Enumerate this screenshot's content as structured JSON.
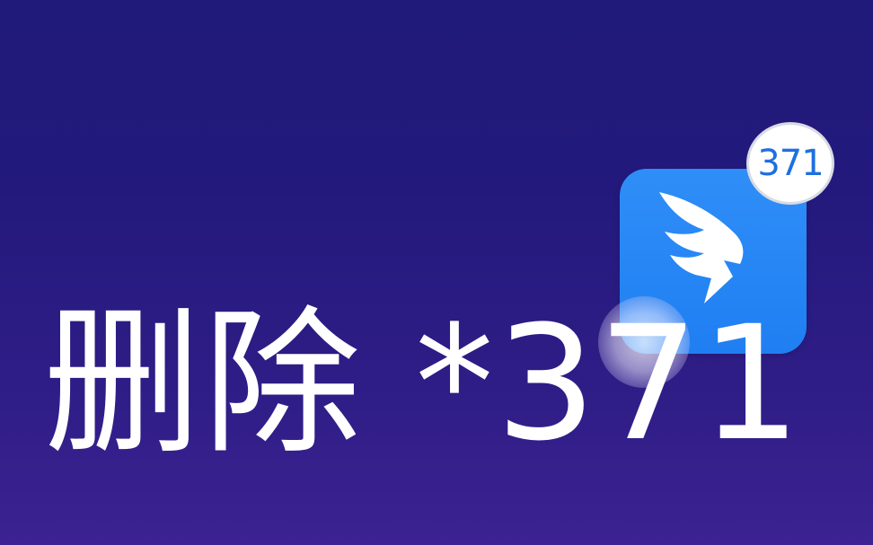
{
  "app_icon": {
    "icon": "dingtalk-wing-icon",
    "color": "#2189f5",
    "badge_count": "371"
  },
  "caption": {
    "text": "删除 *371"
  },
  "colors": {
    "background": "#231a7c",
    "badge_text": "#1e6fe0",
    "caption_text": "#ffffff"
  }
}
